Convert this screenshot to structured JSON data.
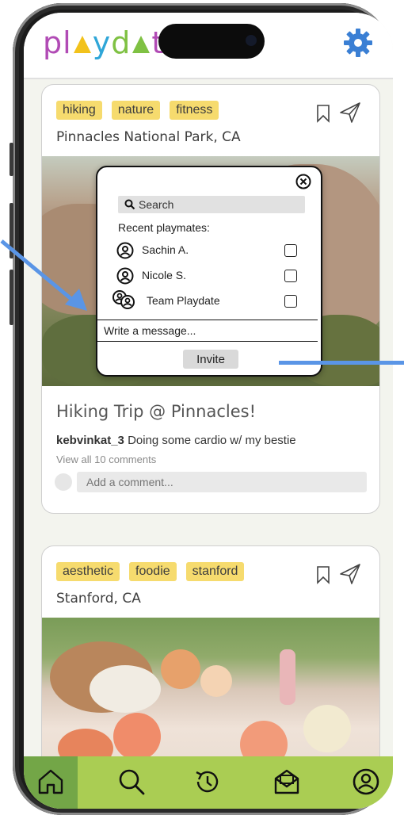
{
  "app": {
    "logo": "playdate",
    "accent_color": "#aacd53",
    "settings_icon": "gear-icon"
  },
  "posts": [
    {
      "tags": [
        "hiking",
        "nature",
        "fitness"
      ],
      "location": "Pinnacles National Park, CA",
      "title": "Hiking Trip @ Pinnacles!",
      "author": "kebvinkat_3",
      "caption": "Doing some cardio w/ my bestie",
      "view_comments": "View all 10 comments",
      "comment_placeholder": "Add a comment..."
    },
    {
      "tags": [
        "aesthetic",
        "foodie",
        "stanford"
      ],
      "location": "Stanford, CA"
    }
  ],
  "invite_modal": {
    "search_placeholder": "Search",
    "recent_label": "Recent playmates:",
    "playmates": [
      {
        "name": "Sachin A.",
        "checked": false
      },
      {
        "name": "Nicole S.",
        "checked": false
      },
      {
        "name": "Team Playdate",
        "checked": false
      }
    ],
    "message_placeholder": "Write a message...",
    "invite_label": "Invite"
  },
  "bottom_nav": {
    "items": [
      "home-icon",
      "search-icon",
      "history-icon",
      "inbox-icon",
      "profile-icon"
    ],
    "active": "home-icon"
  }
}
